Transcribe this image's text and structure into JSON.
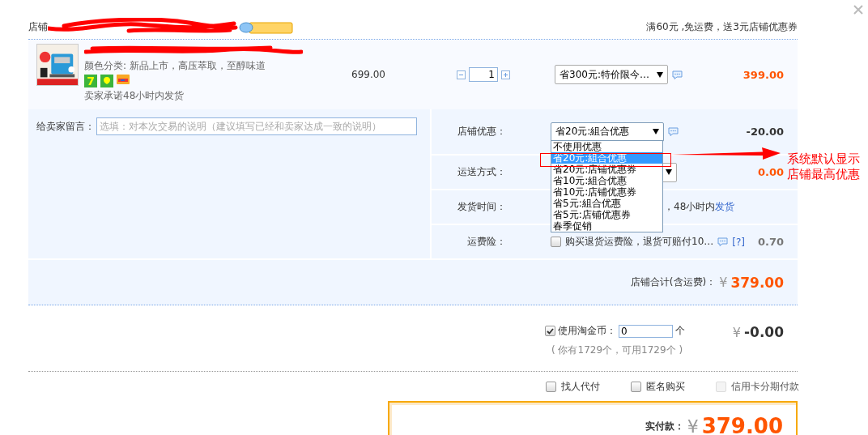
{
  "shop_header": {
    "label": "店铺",
    "promo": "满60元 ,免运费，送3元店铺优惠券"
  },
  "item": {
    "kind": "picture",
    "spec": "颜色分类: 新品上市，高压萃取，至醇味道",
    "badges": [
      {
        "kind": "seven",
        "text": "7"
      },
      {
        "kind": "guarantee"
      },
      {
        "kind": "card"
      }
    ],
    "promise": "卖家承诺48小时内发货",
    "price": "699.00",
    "quantity": "1",
    "promotion": "省300元:特价限今…",
    "total": "399.00"
  },
  "message": {
    "label": "给卖家留言：",
    "placeholder": "选填：对本次交易的说明（建议填写已经和卖家达成一致的说明）"
  },
  "discount": {
    "label": "店铺优惠：",
    "value": "省20元:組合优惠",
    "expanded": true,
    "amount": "-20.00",
    "options": [
      {
        "label": "不使用优惠",
        "selected": false
      },
      {
        "label": "省20元:組合优惠",
        "selected": true
      },
      {
        "label": "省20元:店铺优惠券",
        "selected": false
      },
      {
        "label": "省10元:組合优惠",
        "selected": false
      },
      {
        "label": "省10元:店铺优惠券",
        "selected": false
      },
      {
        "label": "省5元:組合优惠",
        "selected": false
      },
      {
        "label": "省5元:店铺优惠券",
        "selected": false
      },
      {
        "label": "春季促销",
        "selected": false
      }
    ]
  },
  "shipping": {
    "label": "运送方式：",
    "amount": "0.00"
  },
  "delivery": {
    "label": "发货时间：",
    "text": "，48小时内",
    "link": "发货"
  },
  "insurance": {
    "label": "运费险：",
    "checked": false,
    "text": "购买退货运费险，退货可赔付10…",
    "help": "[?]",
    "amount": "0.70"
  },
  "annotation": {
    "lines": [
      "系统默认显示",
      "店铺最高优惠"
    ]
  },
  "shop_total": {
    "label": "店铺合计(含运费)：",
    "currency": "¥",
    "amount": "379.00"
  },
  "coins": {
    "checked": true,
    "label": "使用淘金币：",
    "value": "0",
    "unit": "个",
    "note": "( 你有1729个，可用1729个 )",
    "currency": "¥",
    "amount": "-0.00"
  },
  "extras": [
    {
      "label": "找人代付",
      "checked": false,
      "disabled": false
    },
    {
      "label": "匿名购买",
      "checked": false,
      "disabled": false
    },
    {
      "label": "信用卡分期付款",
      "checked": false,
      "disabled": true
    }
  ],
  "payment": {
    "label": "实付款：",
    "currency": "¥",
    "amount": "379.00"
  }
}
